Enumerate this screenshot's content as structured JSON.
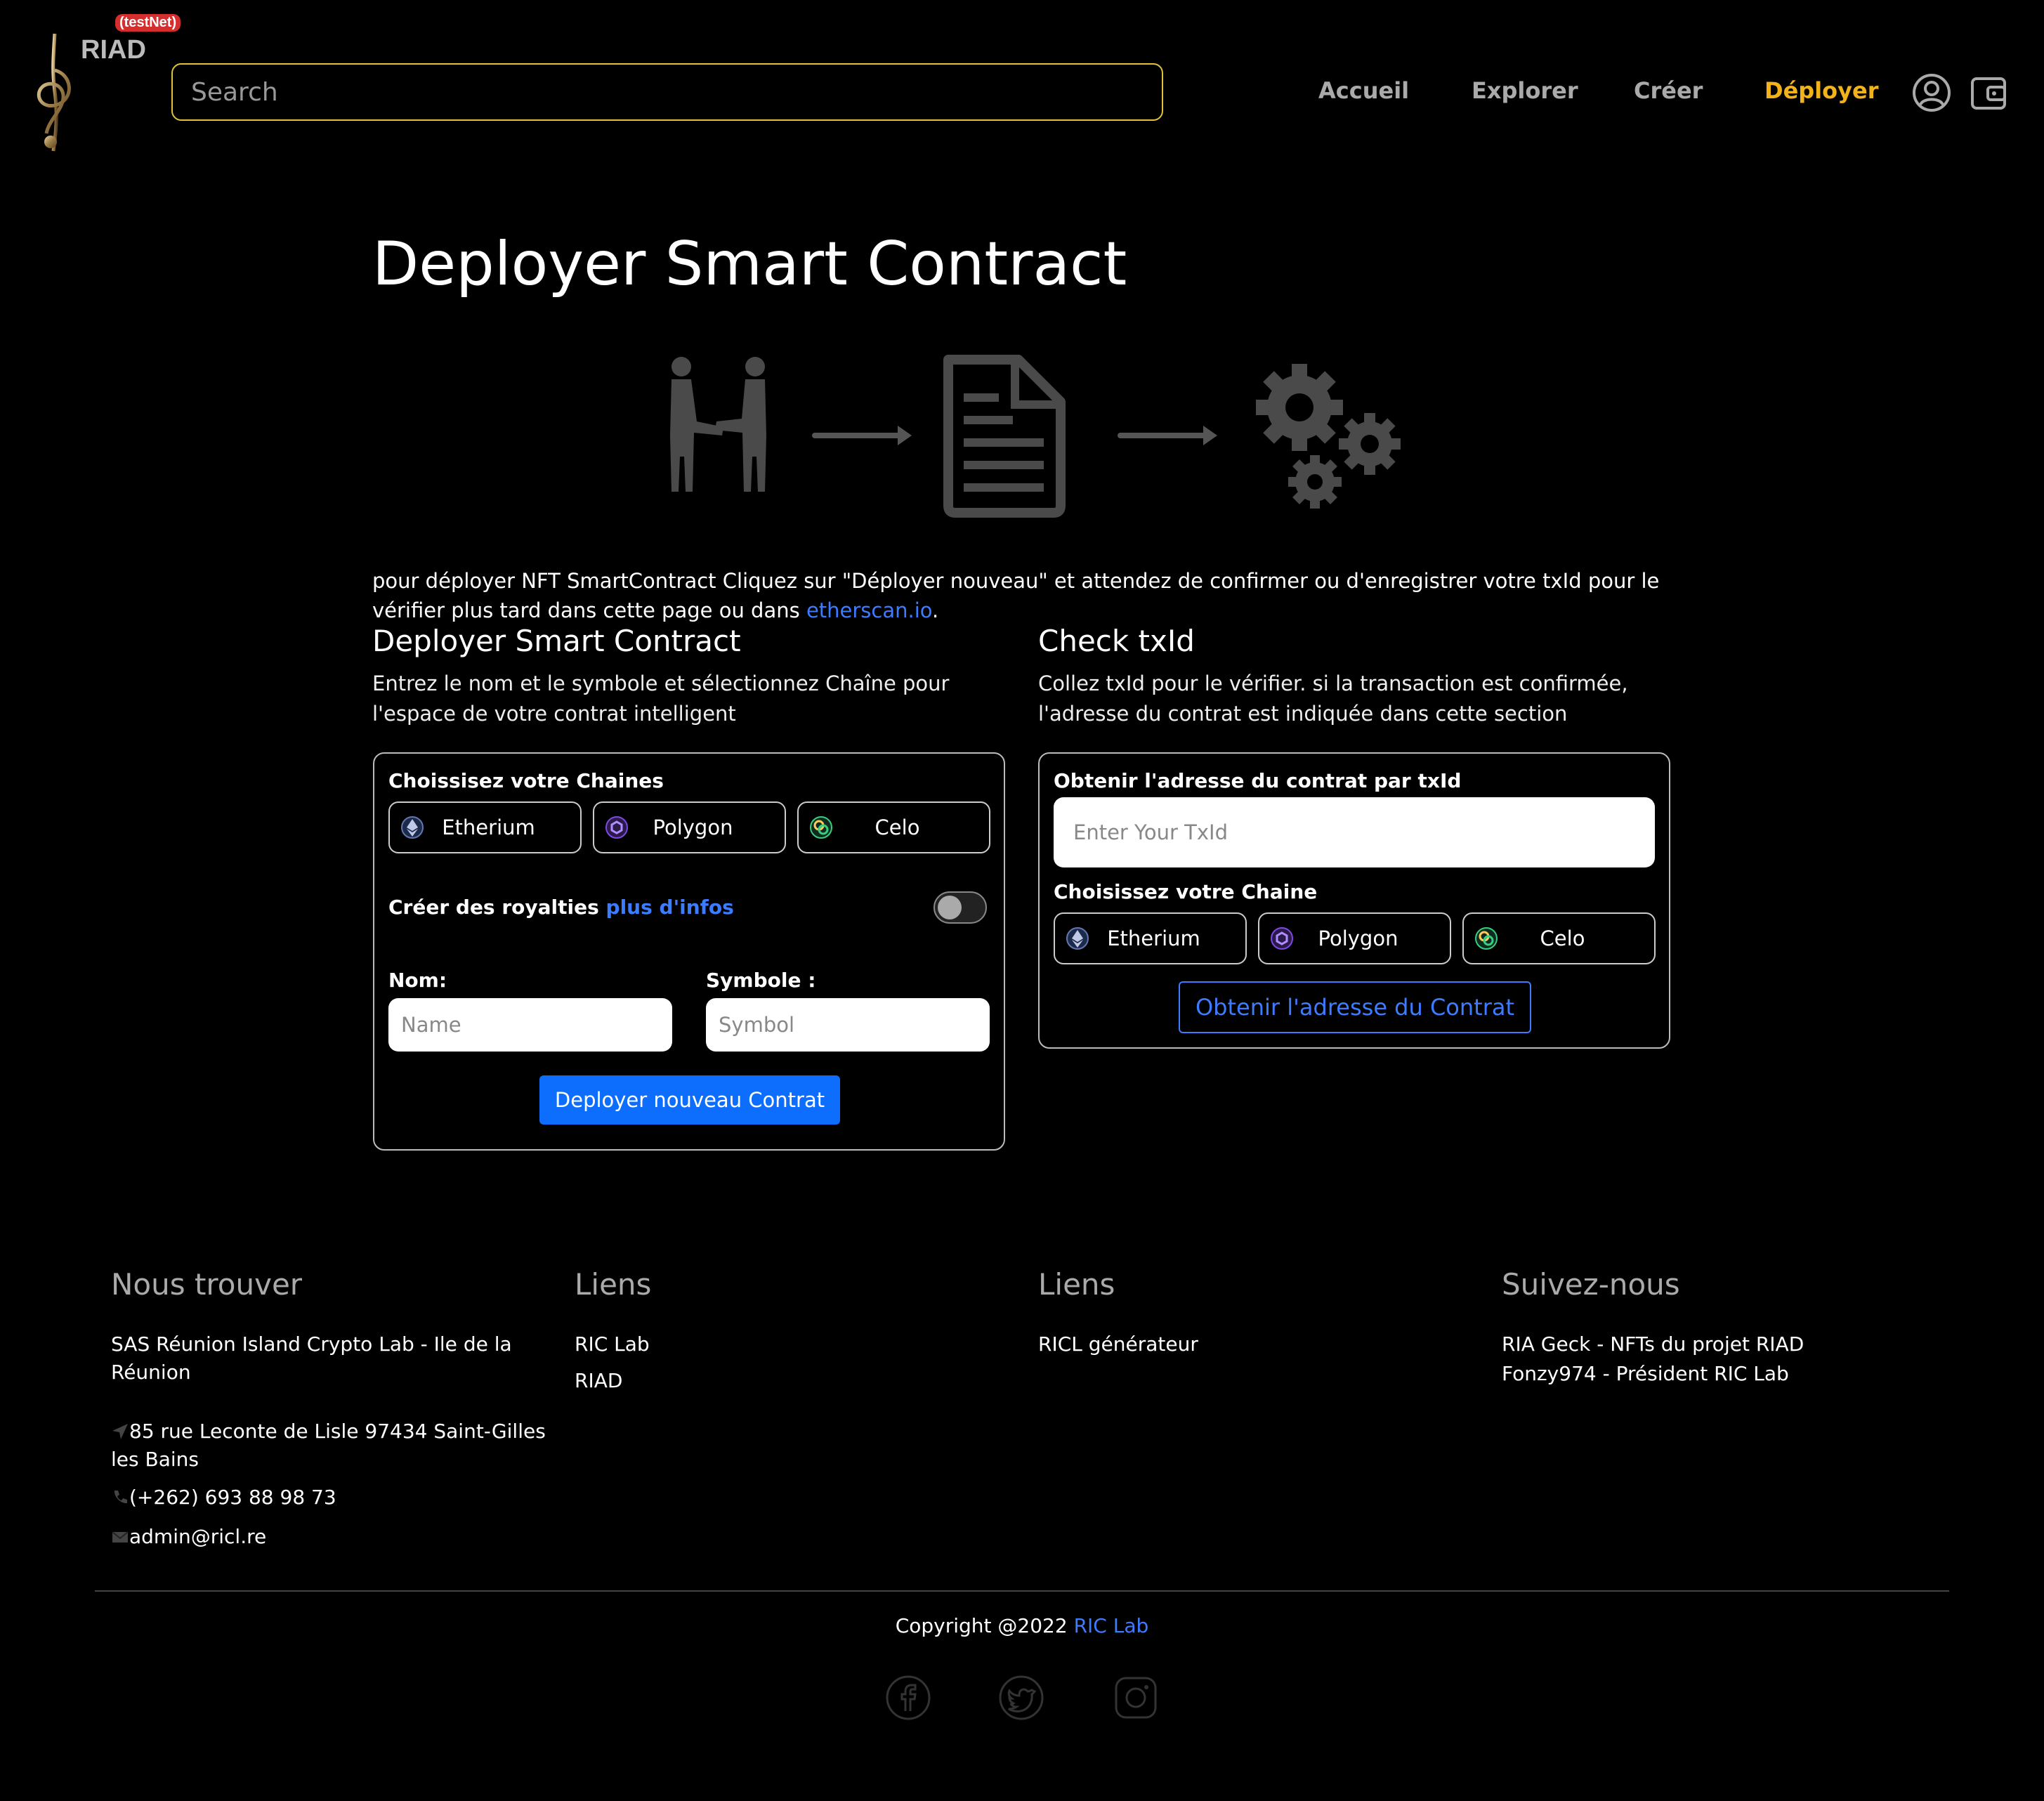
{
  "header": {
    "logo_text": "RIAD",
    "badge": "(testNet)",
    "search_placeholder": "Search",
    "nav": [
      {
        "label": "Accueil",
        "active": false
      },
      {
        "label": "Explorer",
        "active": false
      },
      {
        "label": "Créer",
        "active": false
      },
      {
        "label": "Déployer",
        "active": true
      }
    ],
    "icons": [
      "user-circle-icon",
      "wallet-icon"
    ],
    "accent_color": "#f2b21a"
  },
  "main": {
    "title": "Deployer Smart Contract",
    "illustration_icons": [
      "handshake-icon",
      "arrow-right-icon",
      "document-icon",
      "arrow-right-icon",
      "gears-icon"
    ],
    "intro_text": "pour déployer NFT SmartContract Cliquez sur \"Déployer nouveau\" et attendez de confirmer ou d'enregistrer votre txId pour le vérifier plus tard dans cette page ou dans ",
    "intro_link": "etherscan.io",
    "intro_end": ".",
    "deploy": {
      "heading": "Deployer Smart Contract",
      "description": "Entrez le nom et le symbole et sélectionnez Chaîne pour l'espace de votre contrat intelligent",
      "chains_label": "Choissisez votre Chaines",
      "chains": [
        "Etherium",
        "Polygon",
        "Celo"
      ],
      "royalties_label": "Créer des royalties ",
      "royalties_link": "plus d'infos",
      "royalties_enabled": false,
      "name_label": "Nom:",
      "name_placeholder": "Name",
      "symbol_label": "Symbole :",
      "symbol_placeholder": "Symbol",
      "button": "Deployer nouveau Contrat"
    },
    "check": {
      "heading": "Check txId",
      "description": "Collez txId pour le vérifier. si la transaction est confirmée, l'adresse du contrat est indiquée dans cette section",
      "txid_label": "Obtenir l'adresse du contrat par txId",
      "txid_placeholder": "Enter Your TxId",
      "chain_label": "Choisissez votre Chaine",
      "chains": [
        "Etherium",
        "Polygon",
        "Celo"
      ],
      "button": "Obtenir l'adresse du Contrat"
    },
    "link_color": "#3d7bff",
    "primary_button_color": "#0d6efd"
  },
  "footer": {
    "columns": [
      {
        "heading": "Nous trouver",
        "company": "SAS Réunion Island Crypto Lab - Ile de la Réunion",
        "address": "85 rue Leconte de Lisle 97434 Saint-Gilles les Bains",
        "phone": "(+262) 693 88 98 73",
        "email": "admin@ricl.re"
      },
      {
        "heading": "Liens",
        "links": [
          "RIC Lab",
          "RIAD"
        ]
      },
      {
        "heading": "Liens",
        "links": [
          "RICL générateur"
        ]
      },
      {
        "heading": "Suivez-nous",
        "links": [
          "RIA Geck - NFTs du projet RIAD",
          "Fonzy974 - Président RIC Lab"
        ]
      }
    ],
    "copyright": "Copyright @2022 ",
    "copyright_link": "RIC Lab",
    "social_icons": [
      "facebook-icon",
      "twitter-icon",
      "instagram-icon"
    ]
  }
}
